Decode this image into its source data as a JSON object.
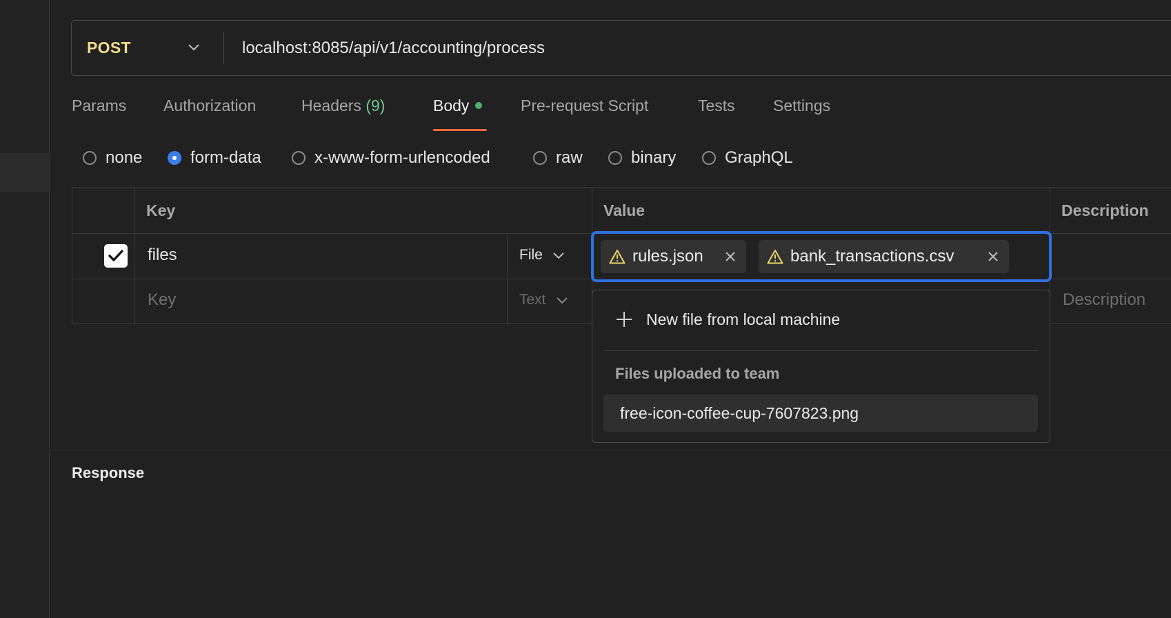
{
  "request": {
    "method": "POST",
    "url": "localhost:8085/api/v1/accounting/process"
  },
  "tabs": {
    "params": "Params",
    "authorization": "Authorization",
    "headers": "Headers",
    "headers_count": "(9)",
    "body": "Body",
    "pre_request": "Pre-request Script",
    "tests": "Tests",
    "settings": "Settings"
  },
  "body_types": {
    "selected": "form-data",
    "options": [
      "none",
      "form-data",
      "x-www-form-urlencoded",
      "raw",
      "binary",
      "GraphQL"
    ]
  },
  "table": {
    "headers": {
      "key": "Key",
      "value": "Value",
      "description": "Description"
    },
    "rows": [
      {
        "checked": true,
        "key": "files",
        "type": "File",
        "value_files": [
          "rules.json",
          "bank_transactions.csv"
        ],
        "description": ""
      }
    ],
    "new_row": {
      "key_placeholder": "Key",
      "type": "Text",
      "description_placeholder": "Description"
    }
  },
  "file_dropdown": {
    "new_file_label": "New file from local machine",
    "section_label": "Files uploaded to team",
    "files": [
      "free-icon-coffee-cup-7607823.png"
    ]
  },
  "response": {
    "title": "Response"
  },
  "colors": {
    "method": "#f1de8c",
    "accent_blue": "#2f6fe0",
    "tab_underline": "#ec6a3b",
    "body_dot": "#4caf6a",
    "headers_count": "#6ec98a",
    "warning": "#f0d36b"
  },
  "icons": [
    "chevron-down-icon",
    "check-icon",
    "warning-icon",
    "close-icon",
    "plus-icon"
  ]
}
